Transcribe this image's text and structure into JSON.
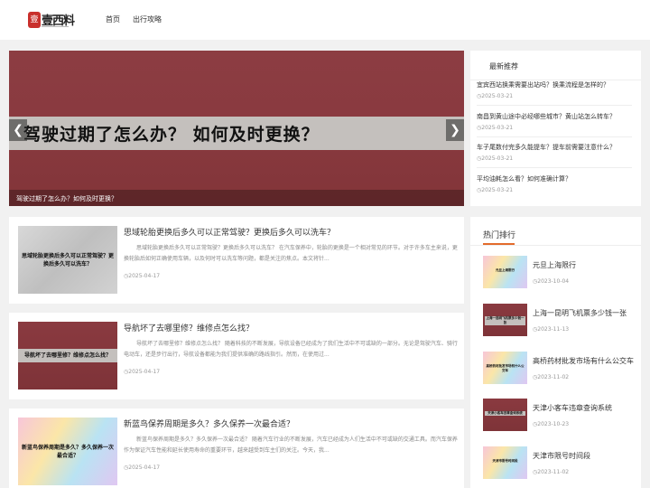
{
  "header": {
    "logo_text": "壹西料",
    "logo_seal": "壹",
    "nav": [
      "首页",
      "出行攻略"
    ]
  },
  "banner": {
    "headline": "驾驶过期了怎么办？ 如何及时更换？",
    "caption": "驾驶过期了怎么办？如何及时更换？",
    "prev_symbol": "❮",
    "next_symbol": "❯"
  },
  "latest": {
    "title": "最新推荐",
    "items": [
      {
        "title": "宜宾西站换乘需要出站吗？换乘流程是怎样的？",
        "date": "2025-03-21"
      },
      {
        "title": "南昌到黄山途中必经哪些城市？黄山站怎么转车？",
        "date": "2025-03-21"
      },
      {
        "title": "车子尾数付完多久能提车？提车前需要注意什么？",
        "date": "2025-03-21"
      },
      {
        "title": "平均油耗怎么看？如何准确计算？",
        "date": "2025-03-21"
      }
    ]
  },
  "articles": [
    {
      "title": "思域轮胎更换后多久可以正常驾驶？更换后多久可以洗车？",
      "summary": "思域轮胎更换后多久可以正常驾驶？更换后多久可以洗车？ 在汽车保养中，轮胎的更换是一个相对常见的环节。对于许多车主来说，更换轮胎后如何正确使用车辆，以及何时可以洗车等问题，都是关注的焦点。本文将针...",
      "date": "2025-04-17",
      "thumb_text": "思域轮胎更换后多久可以正常驾驶？更换后多久可以洗车？"
    },
    {
      "title": "导航坏了去哪里修？维修点怎么找？",
      "summary": "导航坏了去哪里修？维修点怎么找？ 随着科技的不断发展，导航设备已经成为了我们生活中不可或缺的一部分。无论是驾驶汽车、骑行电动车，还是步行出行，导航设备都能为我们提供准确的路线指引。然而，在使用过...",
      "date": "2025-04-17",
      "thumb_text": "导航坏了去哪里修？维修点怎么找？"
    },
    {
      "title": "新蓝鸟保养周期是多久？多久保养一次最合适？",
      "summary": "新蓝鸟保养周期是多久？多久保养一次最合适？ 随着汽车行业的不断发展，汽车已经成为人们生活中不可或缺的交通工具。而汽车保养作为保证汽车性能和延长使用寿命的重要环节，越来越受到车主们的关注。今天，我...",
      "date": "2025-04-17",
      "thumb_text": "新蓝鸟保养周期是多久？多久保养一次最合适？"
    }
  ],
  "hot": {
    "title": "热门排行",
    "items": [
      {
        "name": "元旦上海限行",
        "date": "2023-10-04",
        "thumb_text": "元旦上海限行"
      },
      {
        "name": "上海一昆明飞机票多少钱一张",
        "date": "2023-11-13",
        "thumb_text": "上海一昆明飞机票多少钱一张"
      },
      {
        "name": "高桥药材批发市场有什么公交车",
        "date": "2023-11-02",
        "thumb_text": "高桥药材批发市场有什么公交车"
      },
      {
        "name": "天津小客车违章查询系统",
        "date": "2023-10-23",
        "thumb_text": "天津小客车违章查询系统"
      },
      {
        "name": "天津市限号时间段",
        "date": "2023-11-02",
        "thumb_text": "天津市限号时间段"
      }
    ]
  },
  "colors": {
    "accent": "#e36b2c",
    "banner_bg": "#8a3a40",
    "logo_red": "#c9302c"
  },
  "icons": {
    "date": "clock-icon",
    "banner_prev": "chevron-left-icon",
    "banner_next": "chevron-right-icon"
  }
}
